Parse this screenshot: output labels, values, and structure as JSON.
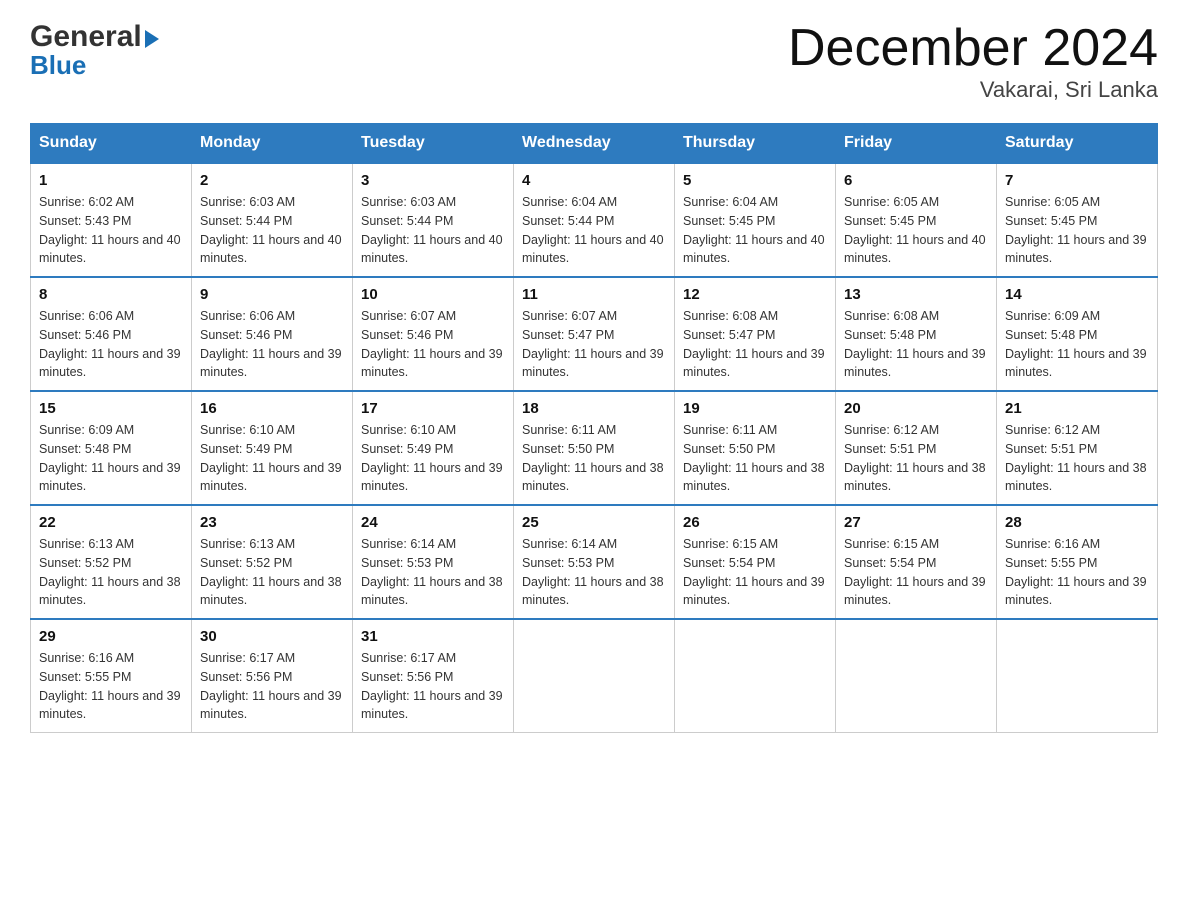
{
  "logo": {
    "general": "General",
    "blue": "Blue"
  },
  "header": {
    "title": "December 2024",
    "subtitle": "Vakarai, Sri Lanka"
  },
  "days_of_week": [
    "Sunday",
    "Monday",
    "Tuesday",
    "Wednesday",
    "Thursday",
    "Friday",
    "Saturday"
  ],
  "weeks": [
    [
      {
        "day": "1",
        "sunrise": "Sunrise: 6:02 AM",
        "sunset": "Sunset: 5:43 PM",
        "daylight": "Daylight: 11 hours and 40 minutes."
      },
      {
        "day": "2",
        "sunrise": "Sunrise: 6:03 AM",
        "sunset": "Sunset: 5:44 PM",
        "daylight": "Daylight: 11 hours and 40 minutes."
      },
      {
        "day": "3",
        "sunrise": "Sunrise: 6:03 AM",
        "sunset": "Sunset: 5:44 PM",
        "daylight": "Daylight: 11 hours and 40 minutes."
      },
      {
        "day": "4",
        "sunrise": "Sunrise: 6:04 AM",
        "sunset": "Sunset: 5:44 PM",
        "daylight": "Daylight: 11 hours and 40 minutes."
      },
      {
        "day": "5",
        "sunrise": "Sunrise: 6:04 AM",
        "sunset": "Sunset: 5:45 PM",
        "daylight": "Daylight: 11 hours and 40 minutes."
      },
      {
        "day": "6",
        "sunrise": "Sunrise: 6:05 AM",
        "sunset": "Sunset: 5:45 PM",
        "daylight": "Daylight: 11 hours and 40 minutes."
      },
      {
        "day": "7",
        "sunrise": "Sunrise: 6:05 AM",
        "sunset": "Sunset: 5:45 PM",
        "daylight": "Daylight: 11 hours and 39 minutes."
      }
    ],
    [
      {
        "day": "8",
        "sunrise": "Sunrise: 6:06 AM",
        "sunset": "Sunset: 5:46 PM",
        "daylight": "Daylight: 11 hours and 39 minutes."
      },
      {
        "day": "9",
        "sunrise": "Sunrise: 6:06 AM",
        "sunset": "Sunset: 5:46 PM",
        "daylight": "Daylight: 11 hours and 39 minutes."
      },
      {
        "day": "10",
        "sunrise": "Sunrise: 6:07 AM",
        "sunset": "Sunset: 5:46 PM",
        "daylight": "Daylight: 11 hours and 39 minutes."
      },
      {
        "day": "11",
        "sunrise": "Sunrise: 6:07 AM",
        "sunset": "Sunset: 5:47 PM",
        "daylight": "Daylight: 11 hours and 39 minutes."
      },
      {
        "day": "12",
        "sunrise": "Sunrise: 6:08 AM",
        "sunset": "Sunset: 5:47 PM",
        "daylight": "Daylight: 11 hours and 39 minutes."
      },
      {
        "day": "13",
        "sunrise": "Sunrise: 6:08 AM",
        "sunset": "Sunset: 5:48 PM",
        "daylight": "Daylight: 11 hours and 39 minutes."
      },
      {
        "day": "14",
        "sunrise": "Sunrise: 6:09 AM",
        "sunset": "Sunset: 5:48 PM",
        "daylight": "Daylight: 11 hours and 39 minutes."
      }
    ],
    [
      {
        "day": "15",
        "sunrise": "Sunrise: 6:09 AM",
        "sunset": "Sunset: 5:48 PM",
        "daylight": "Daylight: 11 hours and 39 minutes."
      },
      {
        "day": "16",
        "sunrise": "Sunrise: 6:10 AM",
        "sunset": "Sunset: 5:49 PM",
        "daylight": "Daylight: 11 hours and 39 minutes."
      },
      {
        "day": "17",
        "sunrise": "Sunrise: 6:10 AM",
        "sunset": "Sunset: 5:49 PM",
        "daylight": "Daylight: 11 hours and 39 minutes."
      },
      {
        "day": "18",
        "sunrise": "Sunrise: 6:11 AM",
        "sunset": "Sunset: 5:50 PM",
        "daylight": "Daylight: 11 hours and 38 minutes."
      },
      {
        "day": "19",
        "sunrise": "Sunrise: 6:11 AM",
        "sunset": "Sunset: 5:50 PM",
        "daylight": "Daylight: 11 hours and 38 minutes."
      },
      {
        "day": "20",
        "sunrise": "Sunrise: 6:12 AM",
        "sunset": "Sunset: 5:51 PM",
        "daylight": "Daylight: 11 hours and 38 minutes."
      },
      {
        "day": "21",
        "sunrise": "Sunrise: 6:12 AM",
        "sunset": "Sunset: 5:51 PM",
        "daylight": "Daylight: 11 hours and 38 minutes."
      }
    ],
    [
      {
        "day": "22",
        "sunrise": "Sunrise: 6:13 AM",
        "sunset": "Sunset: 5:52 PM",
        "daylight": "Daylight: 11 hours and 38 minutes."
      },
      {
        "day": "23",
        "sunrise": "Sunrise: 6:13 AM",
        "sunset": "Sunset: 5:52 PM",
        "daylight": "Daylight: 11 hours and 38 minutes."
      },
      {
        "day": "24",
        "sunrise": "Sunrise: 6:14 AM",
        "sunset": "Sunset: 5:53 PM",
        "daylight": "Daylight: 11 hours and 38 minutes."
      },
      {
        "day": "25",
        "sunrise": "Sunrise: 6:14 AM",
        "sunset": "Sunset: 5:53 PM",
        "daylight": "Daylight: 11 hours and 38 minutes."
      },
      {
        "day": "26",
        "sunrise": "Sunrise: 6:15 AM",
        "sunset": "Sunset: 5:54 PM",
        "daylight": "Daylight: 11 hours and 39 minutes."
      },
      {
        "day": "27",
        "sunrise": "Sunrise: 6:15 AM",
        "sunset": "Sunset: 5:54 PM",
        "daylight": "Daylight: 11 hours and 39 minutes."
      },
      {
        "day": "28",
        "sunrise": "Sunrise: 6:16 AM",
        "sunset": "Sunset: 5:55 PM",
        "daylight": "Daylight: 11 hours and 39 minutes."
      }
    ],
    [
      {
        "day": "29",
        "sunrise": "Sunrise: 6:16 AM",
        "sunset": "Sunset: 5:55 PM",
        "daylight": "Daylight: 11 hours and 39 minutes."
      },
      {
        "day": "30",
        "sunrise": "Sunrise: 6:17 AM",
        "sunset": "Sunset: 5:56 PM",
        "daylight": "Daylight: 11 hours and 39 minutes."
      },
      {
        "day": "31",
        "sunrise": "Sunrise: 6:17 AM",
        "sunset": "Sunset: 5:56 PM",
        "daylight": "Daylight: 11 hours and 39 minutes."
      },
      {
        "day": "",
        "sunrise": "",
        "sunset": "",
        "daylight": ""
      },
      {
        "day": "",
        "sunrise": "",
        "sunset": "",
        "daylight": ""
      },
      {
        "day": "",
        "sunrise": "",
        "sunset": "",
        "daylight": ""
      },
      {
        "day": "",
        "sunrise": "",
        "sunset": "",
        "daylight": ""
      }
    ]
  ]
}
